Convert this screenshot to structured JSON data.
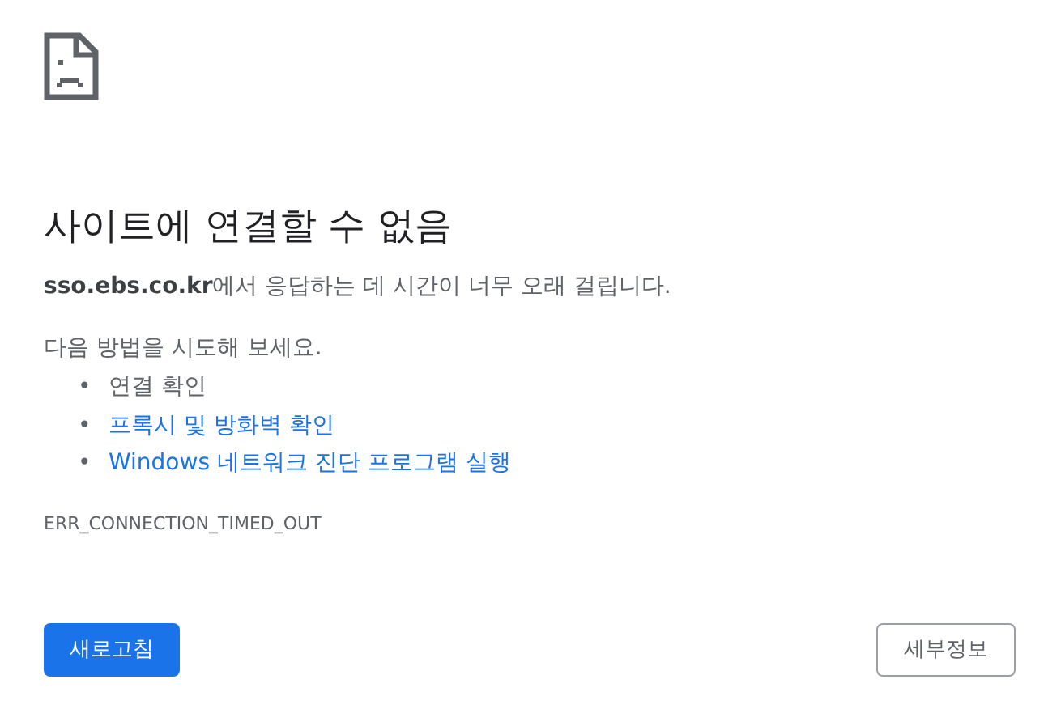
{
  "title": "사이트에 연결할 수 없음",
  "description": {
    "host": "sso.ebs.co.kr",
    "text": "에서 응답하는 데 시간이 너무 오래 걸립니다."
  },
  "suggestions": {
    "heading": "다음 방법을 시도해 보세요.",
    "items": [
      {
        "kind": "text",
        "bullet": "•",
        "label": "연결 확인"
      },
      {
        "kind": "link",
        "bullet": "•",
        "label": "프록시 및 방화벽 확인"
      },
      {
        "kind": "link",
        "bullet": "•",
        "label": "Windows 네트워크 진단 프로그램 실행"
      }
    ]
  },
  "error_code": "ERR_CONNECTION_TIMED_OUT",
  "buttons": {
    "reload": "새로고침",
    "details": "세부정보"
  }
}
